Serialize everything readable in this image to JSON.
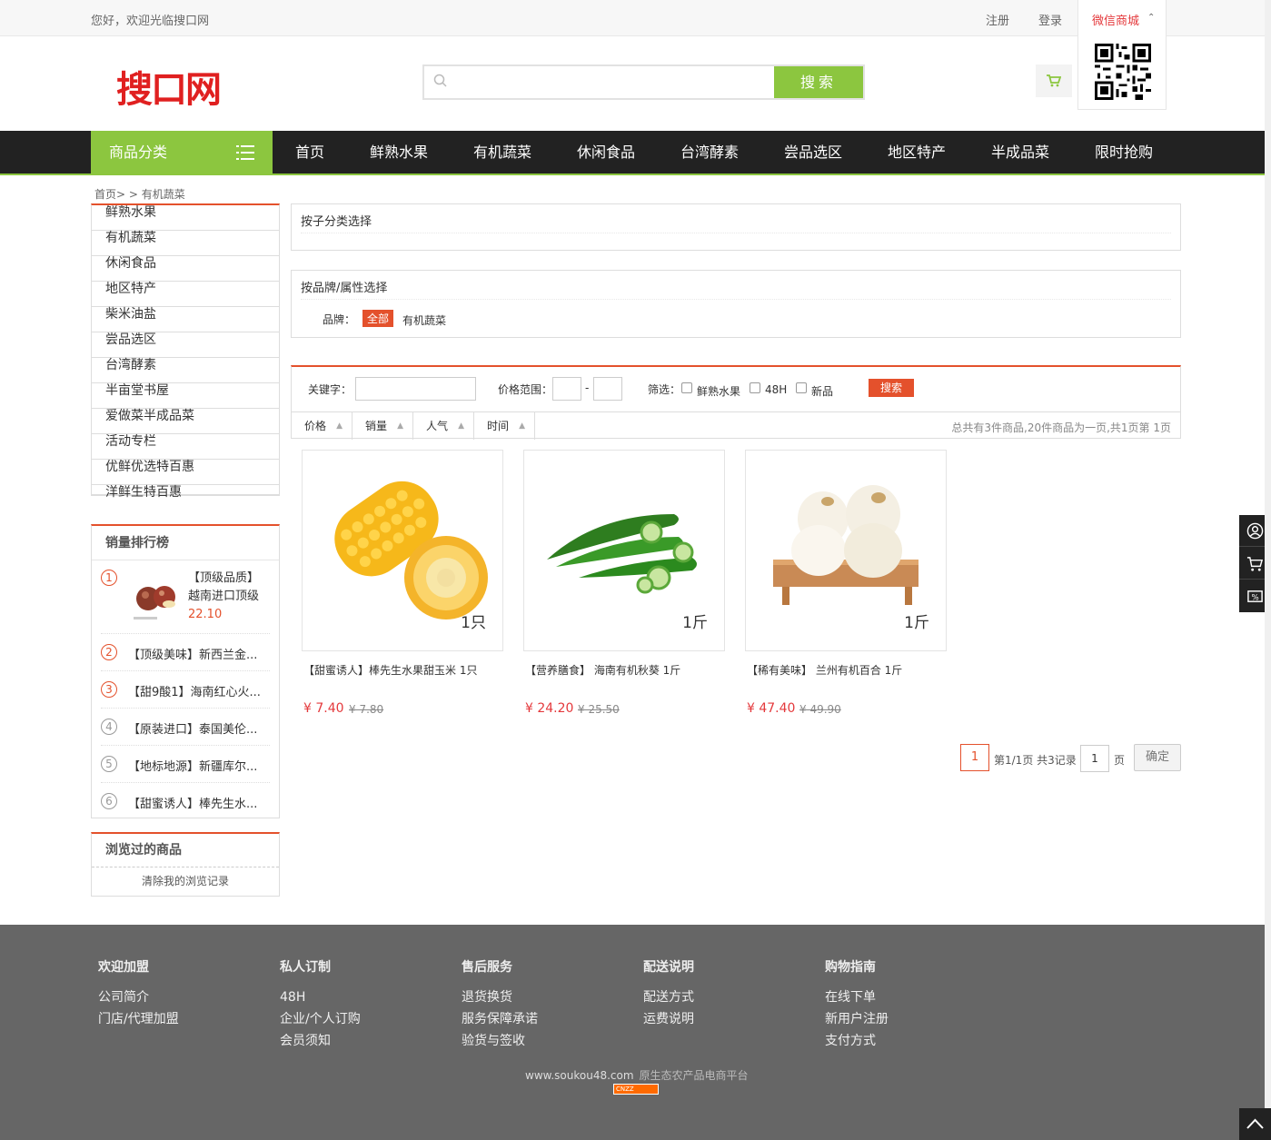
{
  "topbar": {
    "welcome": "您好，欢迎光临搜口网",
    "register": "注册",
    "login": "登录",
    "wechat": "微信商城"
  },
  "header": {
    "logo": "搜口网",
    "search_placeholder": "",
    "search_button": "搜索"
  },
  "nav": {
    "category_label": "商品分类",
    "items": [
      "首页",
      "鲜熟水果",
      "有机蔬菜",
      "休闲食品",
      "台湾酵素",
      "尝品选区",
      "地区特产",
      "半成品菜",
      "限时抢购"
    ]
  },
  "breadcrumb": "首页> > 有机蔬菜",
  "left_categories": [
    "鲜熟水果",
    "有机蔬菜",
    "休闲食品",
    "地区特产",
    "柴米油盐",
    "尝品选区",
    "台湾酵素",
    "半亩堂书屋",
    "爱做菜半成品菜",
    "活动专栏",
    "优鲜优选特百惠",
    "洋鲜生特百惠"
  ],
  "ranking": {
    "title": "销量排行榜",
    "first": {
      "num": "1",
      "name": "【顶级品质】越南进口顶级",
      "price": "22.10"
    },
    "items": [
      {
        "num": "2",
        "name": "【顶级美味】新西兰金..."
      },
      {
        "num": "3",
        "name": "【甜9酸1】海南红心火..."
      },
      {
        "num": "4",
        "name": "【原装进口】泰国美伦..."
      },
      {
        "num": "5",
        "name": "【地标地源】新疆库尔..."
      },
      {
        "num": "6",
        "name": "【甜蜜诱人】棒先生水..."
      }
    ]
  },
  "browsed": {
    "title": "浏览过的商品",
    "clear": "清除我的浏览记录"
  },
  "filters": {
    "category_title": "按子分类选择",
    "brand_title": "按品牌/属性选择",
    "brand_label": "品牌：",
    "brand_all": "全部",
    "brand_item": "有机蔬菜",
    "keyword_label": "关键字：",
    "price_label": "价格范围：",
    "price_sep": "-",
    "filter_label": "筛选：",
    "check_fruit": "鲜熟水果",
    "check_48h": "48H",
    "check_new": "新品",
    "search_button": "搜索",
    "sort": [
      "价格",
      "销量",
      "人气",
      "时间"
    ],
    "summary": "总共有3件商品,20件商品为一页,共1页第 1页"
  },
  "products": [
    {
      "name": "【甜蜜诱人】棒先生水果甜玉米 1只",
      "price": "¥ 7.40",
      "old": "¥ 7.80",
      "unit": "1只"
    },
    {
      "name": "【营养膳食】 海南有机秋葵 1斤",
      "price": "¥ 24.20",
      "old": "¥ 25.50",
      "unit": "1斤"
    },
    {
      "name": "【稀有美味】 兰州有机百合 1斤",
      "price": "¥ 47.40",
      "old": "¥ 49.90",
      "unit": "1斤"
    }
  ],
  "pager": {
    "current": "1",
    "info": "第1/1页 共3记录",
    "input": "1",
    "page_word": "页",
    "ok": "确定"
  },
  "footer": {
    "cols": [
      {
        "title": "欢迎加盟",
        "links": [
          "公司简介",
          "门店/代理加盟"
        ]
      },
      {
        "title": "私人订制",
        "links": [
          "48H",
          "企业/个人订购",
          "会员须知"
        ]
      },
      {
        "title": "售后服务",
        "links": [
          "退货换货",
          "服务保障承诺",
          "验货与签收"
        ]
      },
      {
        "title": "配送说明",
        "links": [
          "配送方式",
          "运费说明"
        ]
      },
      {
        "title": "购物指南",
        "links": [
          "在线下单",
          "新用户注册",
          "支付方式"
        ]
      }
    ],
    "site": "www.soukou48.com",
    "slogan": "原生态农产品电商平台",
    "cnzz": "CNZZ"
  },
  "colors": {
    "accent_green": "#8cc63f",
    "accent_orange": "#e4512c",
    "price_red": "#e4393c",
    "nav_dark": "#222222",
    "footer_gray": "#666666"
  }
}
